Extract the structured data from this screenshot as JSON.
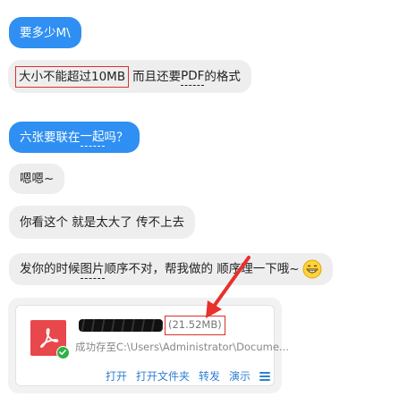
{
  "messages": {
    "m1": "要多少M\\",
    "m2_highlight": "大小不能超过10MB",
    "m2_rest_a": " 而且还要",
    "m2_pdf": "PDF",
    "m2_rest_b": " 的格式",
    "m3_a": "六张要联在",
    "m3_b": "一起",
    "m3_c": "吗？",
    "m4": "嗯嗯~",
    "m5": "你看这个 就是太大了 传不上去",
    "m6_a": "发你的时候",
    "m6_b": "图片",
    "m6_c": "顺序不对，帮我做的 顺序理一下哦~"
  },
  "file_card": {
    "size": "(21.52MB)",
    "path": "成功存至C:\\Users\\Administrator\\Docume...",
    "actions": {
      "open": "打开",
      "open_folder": "打开文件夹",
      "forward": "转发",
      "present": "演示"
    },
    "icon": "pdf-icon"
  },
  "colors": {
    "blue_bubble": "#2f8ff2",
    "gray_bubble": "#eeeeee",
    "highlight_red": "#d9302c",
    "pdf_red": "#e8474c",
    "link_blue": "#2f7fd2"
  }
}
